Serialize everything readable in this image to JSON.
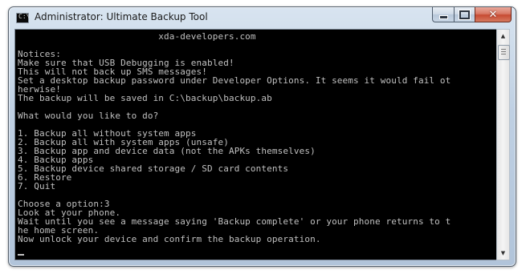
{
  "window": {
    "title": "Administrator:  Ultimate Backup Tool",
    "icon": "command-prompt-icon"
  },
  "controls": {
    "minimize": "minimize-icon",
    "maximize": "maximize-icon",
    "close": "close-icon"
  },
  "console": {
    "lines": [
      "                          xda-developers.com",
      "",
      "Notices:",
      "Make sure that USB Debugging is enabled!",
      "This will not back up SMS messages!",
      "Set a desktop backup password under Developer Options. It seems it would fail ot",
      "herwise!",
      "The backup will be saved in C:\\backup\\backup.ab",
      "",
      "What would you like to do?",
      "",
      "1. Backup all without system apps",
      "2. Backup all with system apps (unsafe)",
      "3. Backup app and device data (not the APKs themselves)",
      "4. Backup apps",
      "5. Backup device shared storage / SD card contents",
      "6. Restore",
      "7. Quit",
      "",
      "Choose a option:3",
      "Look at your phone.",
      "Wait until you see a message saying 'Backup complete' or your phone returns to t",
      "he home screen.",
      "Now unlock your device and confirm the backup operation."
    ]
  }
}
